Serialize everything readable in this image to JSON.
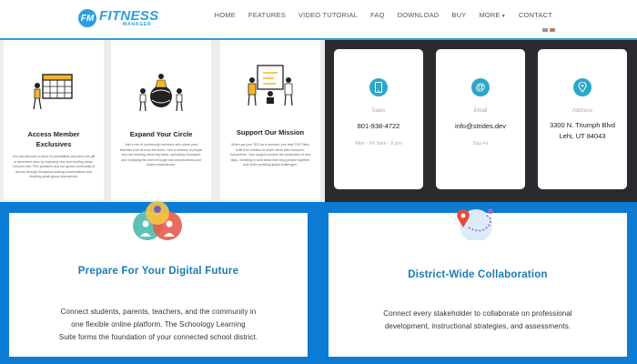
{
  "header": {
    "logo_badge": "FM",
    "logo_main": "FITNESS",
    "logo_sub": "MANAGER",
    "nav": [
      "HOME",
      "FEATURES",
      "VIDEO TUTORIAL",
      "FAQ",
      "DOWNLOAD",
      "BUY",
      "MORE",
      "CONTACT"
    ],
    "flags": [
      "flag-en-icon",
      "flag-es-icon"
    ]
  },
  "feature_cards": [
    {
      "title": "Access Member Exclusives",
      "body": "You can discover a world of possibilities and keep the gift of adventure alive by exploring new and exciting areas. Connect with TED speakers and our global community of donors through thought-provoking conversations and inspiring small group discussions.",
      "icon": "calendar-person-icon"
    },
    {
      "title": "Expand Your Circle",
      "body": "Join a mix of community members who share your interests from around the world. Join a network of people who are thinking about big ideas, spreading innovation and changing the world through real conversations and shared experiences.",
      "icon": "people-globe-icon"
    },
    {
      "title": "Support Our Mission",
      "body": "When you join TED as a member, you help TED Talks fulfill their mission to share ideas with everyone, everywhere. Your support powers the production of new talks, investing in bold ideas that bring people together and solve pressing global challenges.",
      "icon": "people-board-icon"
    }
  ],
  "contact_cards": [
    {
      "label": "Sales",
      "value": "801-938-4722",
      "note": "Mon - Fri 9am - 5 pm",
      "icon": "phone-icon"
    },
    {
      "label": "Email",
      "value": "info@strides.dev",
      "note": "Say Hi",
      "icon": "at-sign-icon"
    },
    {
      "label": "Address",
      "value": "3300 N. Triumph Blvd",
      "value2": "Lehi, UT 84043",
      "icon": "map-pin-icon"
    }
  ],
  "panels": [
    {
      "title": "Prepare For Your Digital Future",
      "lines": [
        "Connect students, parents, teachers, and the community in",
        "one flexible online platform. The Schoology Learning",
        "Suite forms the foundation of your connected school district."
      ],
      "icon": "community-circles-icon"
    },
    {
      "title": "District-Wide Collaboration",
      "lines": [
        "Connect every stakeholder to collaborate on professional",
        "development, instructional strategies, and assessments."
      ],
      "icon": "location-route-icon"
    }
  ],
  "colors": {
    "brand": "#2a9ee0",
    "band": "#0b7bd4",
    "dark": "#2b2b2f",
    "accent": "#2aa7c9"
  }
}
